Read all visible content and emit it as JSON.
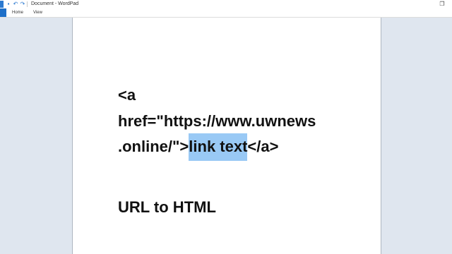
{
  "window": {
    "title": "Document - WordPad",
    "icons": [
      "wordpad-app-icon",
      "save-icon",
      "undo-icon",
      "redo-icon",
      "restore-icon"
    ]
  },
  "ribbon": {
    "tabs": [
      "Home",
      "View"
    ]
  },
  "document": {
    "lines": [
      "<a",
      "href=\"https://www.uwnews",
      ".online/\">",
      "</a>",
      "URL to HTML"
    ],
    "selected_text": "link text"
  }
}
